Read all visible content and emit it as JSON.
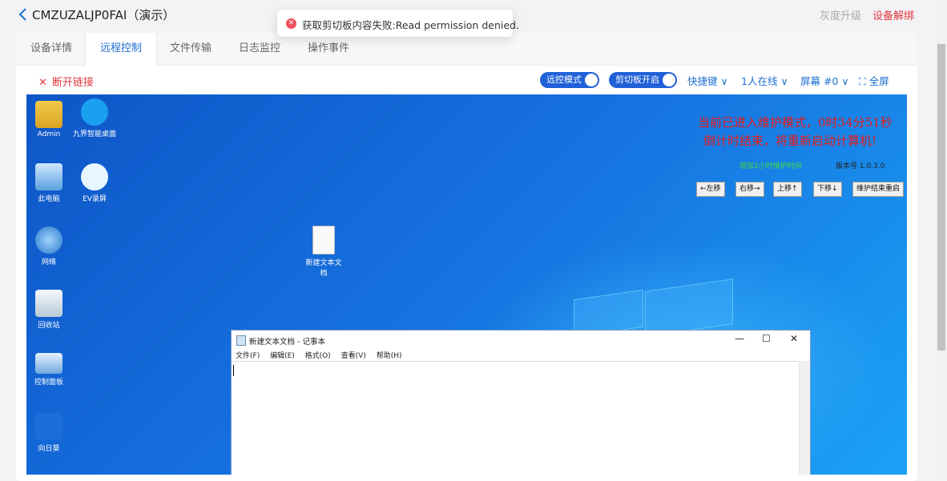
{
  "header": {
    "title": "CMZUZALJP0FAI（演示）",
    "gray_action": "灰度升级",
    "red_action": "设备解绑"
  },
  "toast": {
    "message": "获取剪切板内容失败:Read permission denied."
  },
  "tabs": [
    {
      "label": "设备详情"
    },
    {
      "label": "远程控制"
    },
    {
      "label": "文件传输"
    },
    {
      "label": "日志监控"
    },
    {
      "label": "操作事件"
    }
  ],
  "toolbar": {
    "disconnect": "断开链接",
    "remote_mode": "远控模式",
    "clipboard": "剪切板开启",
    "hotkeys": "快捷键",
    "online": "1人在线",
    "screen": "屏幕 #0",
    "fullscreen": "全屏"
  },
  "desktop": {
    "icons": [
      {
        "label": "Admin"
      },
      {
        "label": "九界智能桌面"
      },
      {
        "label": "此电脑"
      },
      {
        "label": "EV录屏"
      },
      {
        "label": "网络"
      },
      {
        "label": "回收站"
      },
      {
        "label": "控制面板"
      },
      {
        "label": "向日葵"
      },
      {
        "label": "新建文本文档"
      }
    ],
    "warning_line1": "当前已进入维护模式，0时34分51秒",
    "warning_line2": "倒计时结束，将重新启动计算机!",
    "extend_link": "增加1小时维护时间",
    "version": "版本号 1.0.3.0",
    "buttons": [
      {
        "label": "←左移"
      },
      {
        "label": "右移→"
      },
      {
        "label": "上移↑"
      },
      {
        "label": "下移↓"
      },
      {
        "label": "维护结束重启"
      }
    ]
  },
  "notepad": {
    "title": "新建文本文档 - 记事本",
    "menu": [
      "文件(F)",
      "编辑(E)",
      "格式(O)",
      "查看(V)",
      "帮助(H)"
    ],
    "minimize": "—",
    "maximize": "☐",
    "close": "✕"
  }
}
